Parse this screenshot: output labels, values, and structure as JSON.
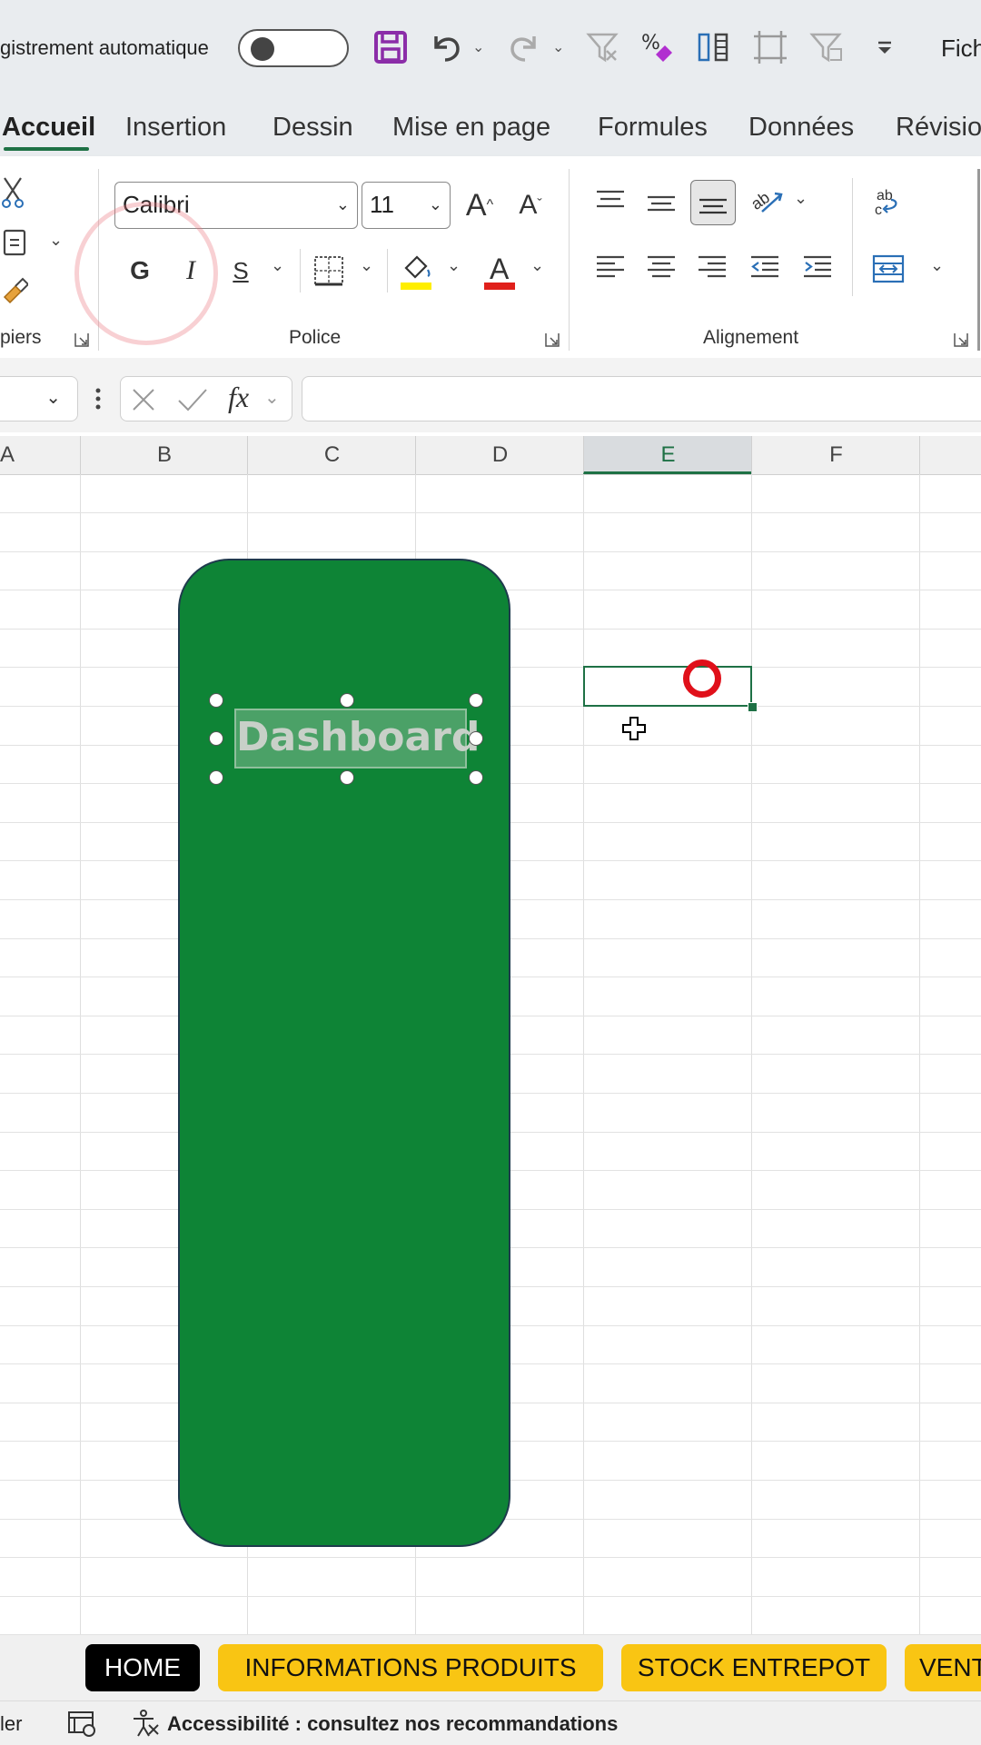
{
  "quick_access": {
    "autosave_label": "gistrement automatique",
    "file_label": "Fich",
    "icons": [
      "save-icon",
      "undo-icon",
      "redo-icon",
      "clear-filter-icon",
      "percent-format-icon",
      "text-to-columns-icon",
      "select-objects-icon",
      "filter-icon",
      "customize-qat-icon"
    ]
  },
  "tabs": [
    "Accueil",
    "Insertion",
    "Dessin",
    "Mise en page",
    "Formules",
    "Données",
    "Révisio"
  ],
  "active_tab": "Accueil",
  "ribbon": {
    "clipboard_label": "piers",
    "font": {
      "label": "Police",
      "name": "Calibri",
      "size": "11",
      "bold": "G",
      "italic": "I",
      "underline": "S",
      "fill_color": "#ffee00",
      "font_color": "#e0201b"
    },
    "alignment_label": "Alignement"
  },
  "formula_bar": {
    "name_box": "",
    "fx": "fx",
    "value": ""
  },
  "columns": [
    "A",
    "B",
    "C",
    "D",
    "E",
    "F"
  ],
  "selected_column": "E",
  "shape": {
    "text": "Dashboard",
    "fill": "#0e8436"
  },
  "sheet_tabs": [
    {
      "label": "HOME",
      "style": "active"
    },
    {
      "label": "INFORMATIONS PRODUITS",
      "style": "yellow"
    },
    {
      "label": "STOCK ENTREPOT",
      "style": "yellow"
    },
    {
      "label": "VENT",
      "style": "yellow"
    }
  ],
  "status": {
    "left": "ler",
    "accessibility": "Accessibilité : consultez nos recommandations"
  },
  "colors": {
    "accent": "#1e7145",
    "tab_yellow": "#f9c513",
    "tab_active_bg": "#000000",
    "cursor_ring": "#e0101a"
  }
}
